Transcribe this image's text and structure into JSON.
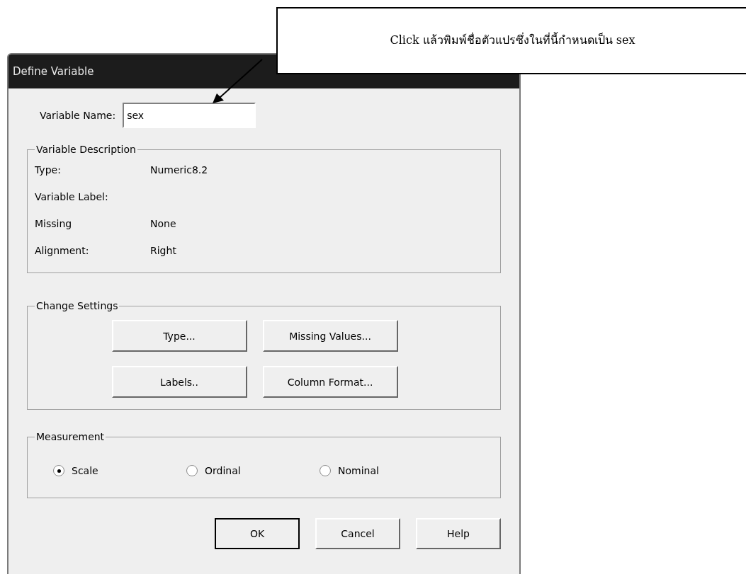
{
  "callout": {
    "text": "Click แล้วพิมพ์ชื่อตัวแปรซึ่งในที่นี้กำหนดเป็น sex"
  },
  "window": {
    "title": "Define Variable"
  },
  "variable_name": {
    "label": "Variable Name:",
    "value": "sex"
  },
  "variable_description": {
    "title": "Variable Description",
    "rows": [
      {
        "label": "Type:",
        "value": "Numeric8.2"
      },
      {
        "label": "Variable Label:"
      },
      {
        "label": "Missing",
        "value": "None"
      },
      {
        "label": "Alignment:",
        "value": "Right"
      }
    ]
  },
  "change_settings": {
    "title": "Change Settings",
    "buttons": [
      {
        "label": "Type..."
      },
      {
        "label": "Missing Values..."
      },
      {
        "label": "Labels.."
      },
      {
        "label": "Column Format..."
      }
    ]
  },
  "measurement": {
    "title": "Measurement",
    "options": [
      {
        "label": "Scale",
        "selected": true
      },
      {
        "label": "Ordinal",
        "selected": false
      },
      {
        "label": "Nominal",
        "selected": false
      }
    ]
  },
  "buttons": [
    {
      "label": "OK",
      "default": true
    },
    {
      "label": "Cancel",
      "default": false
    },
    {
      "label": "Help",
      "default": false
    }
  ]
}
